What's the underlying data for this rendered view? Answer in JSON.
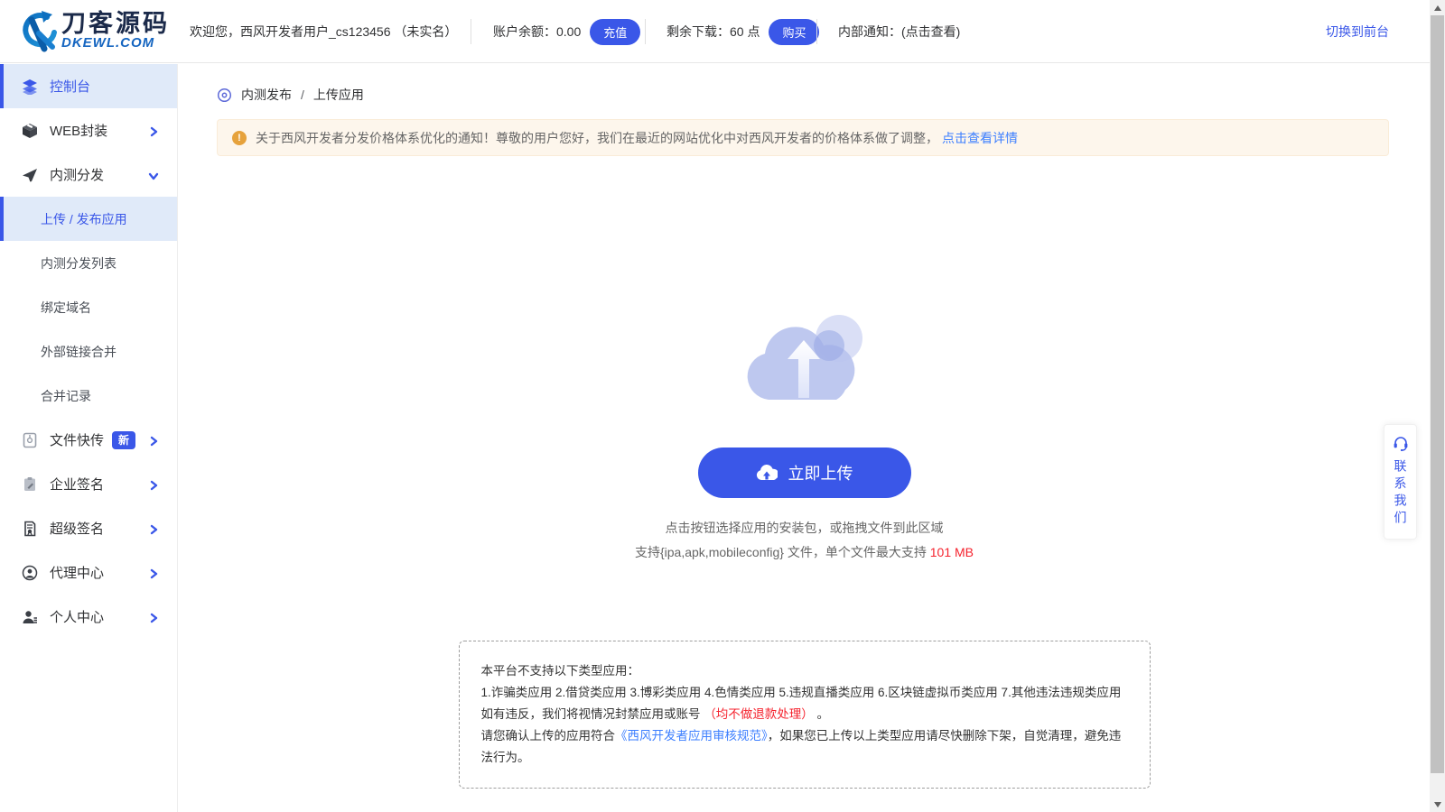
{
  "header": {
    "logo": {
      "title": "刀客源码",
      "domain": "DKEWL.COM"
    },
    "welcome": "欢迎您，西风开发者用户_cs123456 （未实名）",
    "balance": {
      "label": "账户余额：",
      "value": "0.00",
      "button": "充值"
    },
    "downloads": {
      "label": "剩余下载：",
      "value": "60 点",
      "button": "购买"
    },
    "notice": {
      "label": "内部通知：",
      "value": "(点击查看)"
    },
    "switch_front": "切换到前台"
  },
  "sidebar": {
    "items": [
      {
        "label": "控制台",
        "icon": "layers-icon",
        "active": true
      },
      {
        "label": "WEB封装",
        "icon": "cube-icon"
      },
      {
        "label": "内测分发",
        "icon": "paper-plane-icon",
        "expanded": true
      },
      {
        "label": "文件快传",
        "icon": "file-icon",
        "badge": "新"
      },
      {
        "label": "企业签名",
        "icon": "clipboard-pen-icon"
      },
      {
        "label": "超级签名",
        "icon": "certificate-icon"
      },
      {
        "label": "代理中心",
        "icon": "agent-icon"
      },
      {
        "label": "个人中心",
        "icon": "user-icon"
      }
    ],
    "subitems": [
      {
        "label": "上传 / 发布应用",
        "active": true
      },
      {
        "label": "内测分发列表"
      },
      {
        "label": "绑定域名"
      },
      {
        "label": "外部链接合并"
      },
      {
        "label": "合并记录"
      }
    ]
  },
  "breadcrumb": {
    "section": "内测发布",
    "separator": "/",
    "page": "上传应用"
  },
  "alert": {
    "text": "关于西风开发者分发价格体系优化的通知！尊敬的用户您好，我们在最近的网站优化中对西风开发者的价格体系做了调整，",
    "link": "点击查看详情"
  },
  "upload": {
    "button_label": "立即上传",
    "hint1": "点击按钮选择应用的安装包，或拖拽文件到此区域",
    "hint2_prefix": "支持{ipa,apk,mobileconfig} 文件，单个文件最大支持 ",
    "hint2_max": "101 MB"
  },
  "rules": {
    "line1": "本平台不支持以下类型应用：",
    "line2": "1.诈骗类应用 2.借贷类应用 3.博彩类应用 4.色情类应用 5.违规直播类应用 6.区块链虚拟币类应用 7.其他违法违规类应用",
    "line3_prefix": "如有违反，我们将视情况封禁应用或账号 ",
    "line3_red": "（均不做退款处理）",
    "line3_suffix": " 。",
    "line4_prefix": "请您确认上传的应用符合",
    "line4_link": "《西风开发者应用审核规范》",
    "line4_suffix": "，如果您已上传以上类型应用请尽快删除下架，自觉清理，避免违法行为。"
  },
  "contact": {
    "label": "联系我们",
    "icon": "headset-icon"
  },
  "colors": {
    "primary": "#3a57e8",
    "active_bg": "#e0eaf9",
    "link_blue": "#3d7fff",
    "alert_bg": "#fdf6ec",
    "warn_orange": "#e6a23c",
    "danger_red": "#f5222d"
  }
}
